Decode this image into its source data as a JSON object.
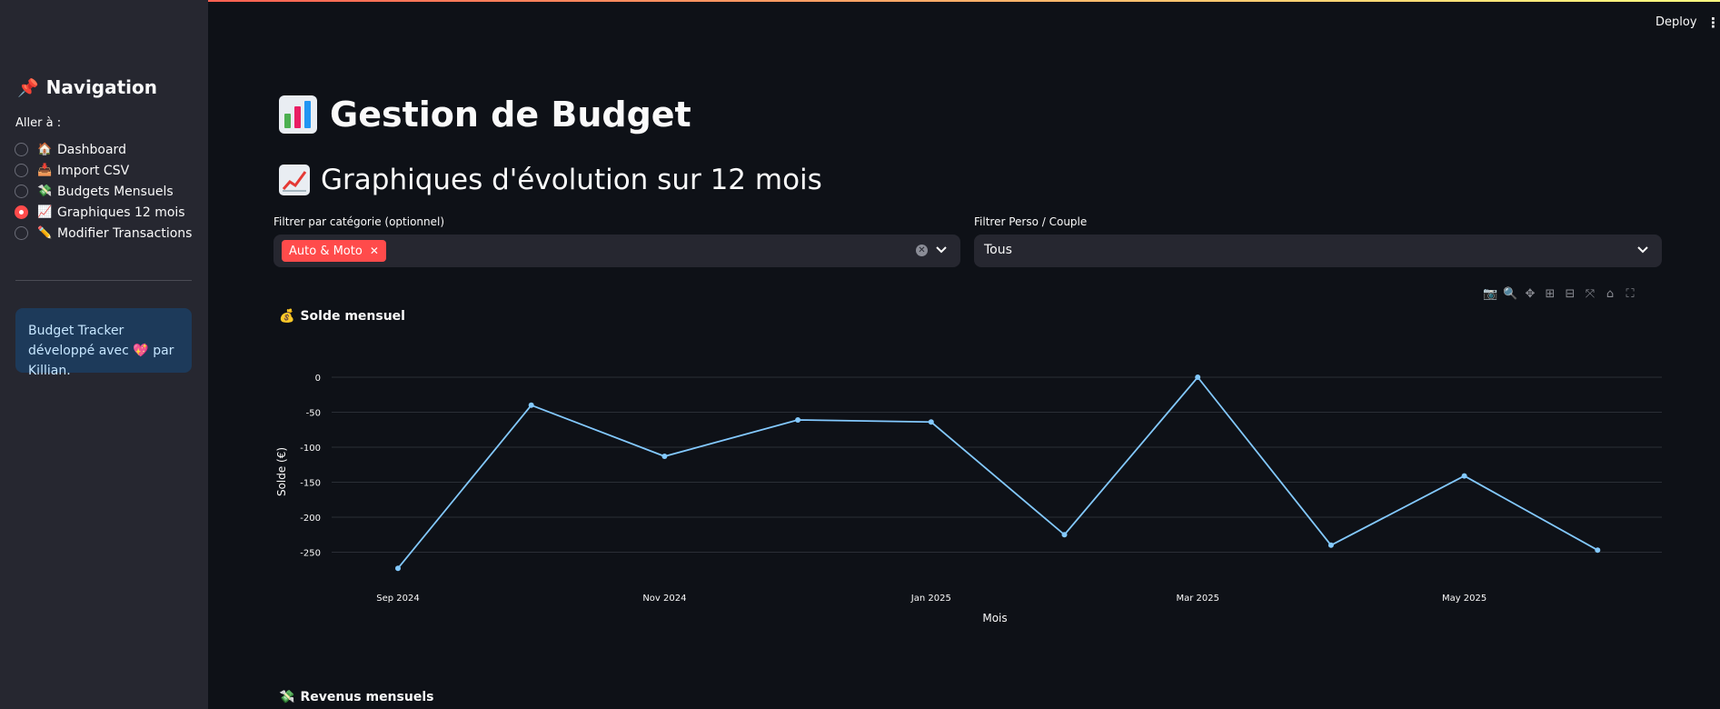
{
  "sidebar": {
    "title_emoji": "📌",
    "title": "Navigation",
    "goto_label": "Aller à :",
    "items": [
      {
        "emoji": "🏠",
        "label": "Dashboard",
        "checked": false
      },
      {
        "emoji": "📥",
        "label": "Import CSV",
        "checked": false
      },
      {
        "emoji": "💸",
        "label": "Budgets Mensuels",
        "checked": false
      },
      {
        "emoji": "📈",
        "label": "Graphiques 12 mois",
        "checked": true
      },
      {
        "emoji": "✏️",
        "label": "Modifier Transactions",
        "checked": false
      }
    ],
    "info_text": "Budget Tracker développé avec 💖 par Killian."
  },
  "header": {
    "deploy_label": "Deploy",
    "menu_icon": "⋮"
  },
  "main": {
    "title": "Gestion de Budget",
    "subtitle": "Graphiques d'évolution sur 12 mois",
    "category_filter": {
      "label": "Filtrer par catégorie (optionnel)",
      "selected_tag": "Auto & Moto"
    },
    "perso_filter": {
      "label": "Filtrer Perso / Couple",
      "value": "Tous"
    },
    "chart_section_emoji": "💰",
    "chart_section_title": "Solde mensuel",
    "next_section_emoji": "💸",
    "next_section_title": "Revenus mensuels"
  },
  "colors": {
    "accent": "#ff4b4b",
    "line": "#83c9ff",
    "background": "#0e1117",
    "sidebar": "#262730"
  },
  "chart_data": {
    "type": "line",
    "title": "",
    "xlabel": "Mois",
    "ylabel": "Solde (€)",
    "x": [
      "2024-09",
      "2024-10",
      "2024-11",
      "2024-12",
      "2025-01",
      "2025-02",
      "2025-03",
      "2025-04",
      "2025-05",
      "2025-06"
    ],
    "x_tick_labels": [
      "Sep 2024",
      "Nov 2024",
      "Jan 2025",
      "Mar 2025",
      "May 2025"
    ],
    "y_ticks": [
      0,
      -50,
      -100,
      -150,
      -200,
      -250
    ],
    "ylim": [
      -275,
      0
    ],
    "grid": true,
    "series": [
      {
        "values": [
          -273,
          -40,
          -113,
          -61,
          -64,
          -225,
          0,
          -240,
          -141,
          -247
        ]
      }
    ]
  }
}
